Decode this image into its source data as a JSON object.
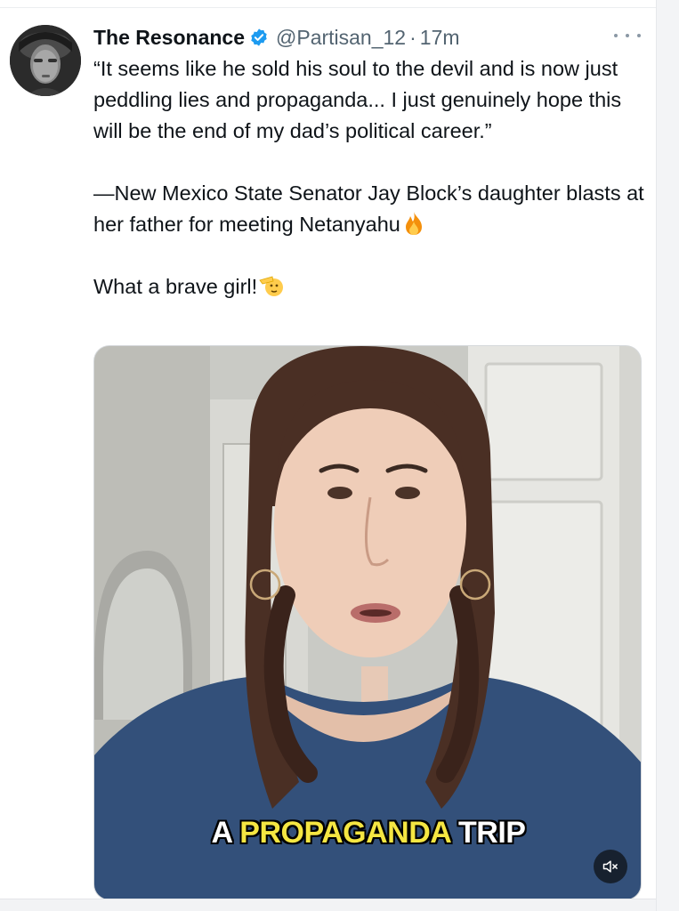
{
  "tweet": {
    "author": {
      "display_name": "The Resonance",
      "handle": "@Partisan_12",
      "separator": "·",
      "time": "17m",
      "verified": true,
      "avatar_icon": "profile-photo"
    },
    "text": {
      "quote": "“It seems like he sold his soul to the devil and is now just peddling lies and propaganda... I just genuinely hope this will be the end of my dad’s political career.”",
      "attribution": "—New Mexico State Senator Jay Block’s daughter blasts at her father for meeting Netanyahu",
      "attribution_emoji": "fire-emoji",
      "closing": "What a brave girl!",
      "closing_emoji": "saluting-face-emoji"
    },
    "media": {
      "type": "video",
      "caption_part1": "A ",
      "caption_part2": "PROPAGANDA",
      "caption_part3": " TRIP",
      "caption_colors": {
        "white": "#ffffff",
        "yellow": "#f5e642"
      },
      "mute_icon": "speaker-muted-icon"
    },
    "more_icon": "more-options-icon"
  },
  "colors": {
    "text_primary": "#0f1419",
    "text_secondary": "#536471",
    "verified_blue": "#1d9bf0"
  }
}
